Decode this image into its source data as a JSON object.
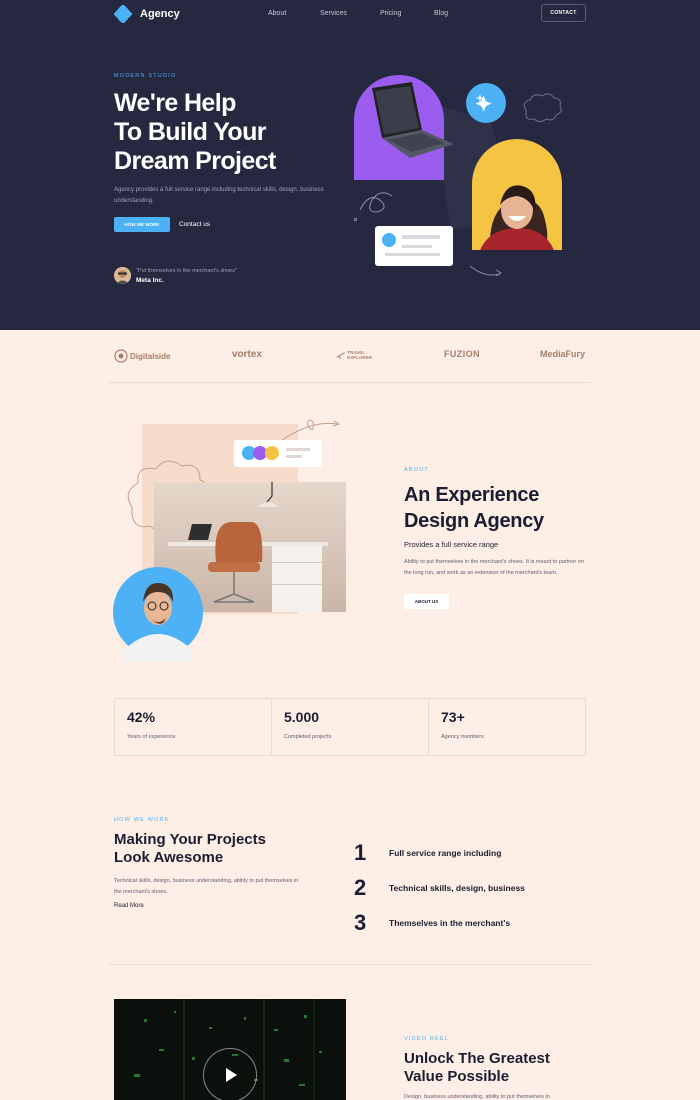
{
  "nav": {
    "brand": "Agency",
    "links": [
      "About",
      "Services",
      "Pricing",
      "Blog"
    ],
    "contact_label": "CONTACT"
  },
  "hero": {
    "eyebrow": "MODERN STUDIO",
    "title_lines": [
      "We're Help",
      "To Build Your",
      "Dream Project"
    ],
    "description": "Agency provides a full service range including technical skills, design, business understanding.",
    "primary_button": "HOW WE WORK",
    "secondary_link": "Contact us",
    "testimonial_quote": "\"Put themselves in the merchant's shoes\"",
    "testimonial_company": "Meta Inc."
  },
  "logos": [
    "Digitalside",
    "vortex",
    "TRAVEL EXPLORER",
    "FUZION",
    "MediaFury"
  ],
  "about": {
    "eyebrow": "ABOUT",
    "title_lines": [
      "An Experience",
      "Design Agency"
    ],
    "subtitle": "Provides a full service range",
    "description": "Ability to put themselves in the merchant's shoes. It is meant to partner on the long run, and work as an extension of the merchant's team.",
    "button": "ABOUT US"
  },
  "stats": [
    {
      "value": "42%",
      "label": "Years of experience"
    },
    {
      "value": "5.000",
      "label": "Completed projects"
    },
    {
      "value": "73+",
      "label": "Agency members"
    }
  ],
  "how_we_work": {
    "eyebrow": "HOW WE WORK",
    "title_lines": [
      "Making Your Projects",
      "Look Awesome"
    ],
    "description": "Technical skills, design, business understanding, ability to put themselves in the merchant's shoes.",
    "read_more": "Read More",
    "steps": [
      {
        "num": "1",
        "text": "Full service range including"
      },
      {
        "num": "2",
        "text": "Technical skills, design, business"
      },
      {
        "num": "3",
        "text": "Themselves in the merchant's"
      }
    ]
  },
  "video_reel": {
    "eyebrow": "VIDEO REEL",
    "title_lines": [
      "Unlock The Greatest",
      "Value Possible"
    ],
    "description": "Design, business understanding, ability to put themselves in"
  },
  "colors": {
    "hero_bg": "#262840",
    "accent": "#4cb1f5",
    "page_bg": "#fdefe5",
    "purple": "#9b5cf0",
    "yellow": "#f6c443"
  }
}
